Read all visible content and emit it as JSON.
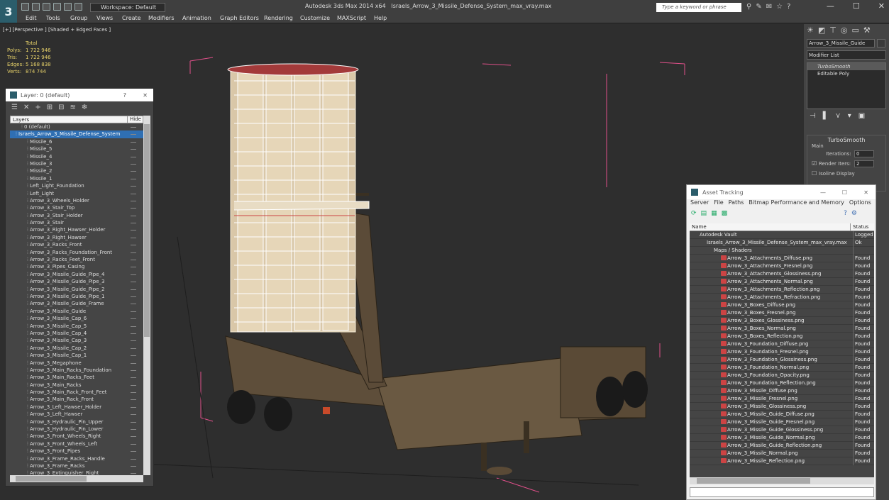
{
  "app": {
    "title": "Autodesk 3ds Max  2014 x64",
    "file": "Israels_Arrow_3_Missile_Defense_System_max_vray.max",
    "workspace": "Workspace: Default",
    "search_placeholder": "Type a keyword or phrase",
    "minimize": "—",
    "maximize": "☐",
    "close": "✕"
  },
  "menu": [
    "Edit",
    "Tools",
    "Group",
    "Views",
    "Create",
    "Modifiers",
    "Animation",
    "Graph Editors",
    "Rendering",
    "Customize",
    "MAXScript",
    "Help"
  ],
  "viewport": {
    "label": "[+] [Perspective ] [Shaded + Edged Faces ]",
    "stats": {
      "title": "Total",
      "polys_label": "Polys:",
      "polys": "1 722 946",
      "tris_label": "Tris:",
      "tris": "1 722 946",
      "edges_label": "Edges:",
      "edges": "5 168 838",
      "verts_label": "Verts:",
      "verts": "874 744"
    }
  },
  "layer_panel": {
    "title": "Layer: 0 (default)",
    "help": "?",
    "close": "✕",
    "col_layers": "Layers",
    "col_hide": "Hide",
    "items": [
      {
        "label": "0 (default)",
        "indent": 2,
        "selected": false
      },
      {
        "label": "Israels_Arrow_3_Missile_Defense_System",
        "indent": 1,
        "selected": true
      },
      {
        "label": "Missile_6",
        "indent": 3
      },
      {
        "label": "Missile_5",
        "indent": 3
      },
      {
        "label": "Missile_4",
        "indent": 3
      },
      {
        "label": "Missile_3",
        "indent": 3
      },
      {
        "label": "Missile_2",
        "indent": 3
      },
      {
        "label": "Missile_1",
        "indent": 3
      },
      {
        "label": "Left_Light_Foundation",
        "indent": 3
      },
      {
        "label": "Left_Light",
        "indent": 3
      },
      {
        "label": "Arrow_3_Wheels_Holder",
        "indent": 3
      },
      {
        "label": "Arrow_3_Stair_Top",
        "indent": 3
      },
      {
        "label": "Arrow_3_Stair_Holder",
        "indent": 3
      },
      {
        "label": "Arrow_3_Stair",
        "indent": 3
      },
      {
        "label": "Arrow_3_Right_Hawser_Holder",
        "indent": 3
      },
      {
        "label": "Arrow_3_Right_Hawser",
        "indent": 3
      },
      {
        "label": "Arrow_3_Racks_Front",
        "indent": 3
      },
      {
        "label": "Arrow_3_Racks_Foundation_Front",
        "indent": 3
      },
      {
        "label": "Arrow_3_Racks_Feet_Front",
        "indent": 3
      },
      {
        "label": "Arrow_3_Pipes_Casing",
        "indent": 3
      },
      {
        "label": "Arrow_3_Missile_Guide_Pipe_4",
        "indent": 3
      },
      {
        "label": "Arrow_3_Missile_Guide_Pipe_3",
        "indent": 3
      },
      {
        "label": "Arrow_3_Missile_Guide_Pipe_2",
        "indent": 3
      },
      {
        "label": "Arrow_3_Missile_Guide_Pipe_1",
        "indent": 3
      },
      {
        "label": "Arrow_3_Missile_Guide_Frame",
        "indent": 3
      },
      {
        "label": "Arrow_3_Missile_Guide",
        "indent": 3
      },
      {
        "label": "Arrow_3_Missile_Cap_6",
        "indent": 3
      },
      {
        "label": "Arrow_3_Missile_Cap_5",
        "indent": 3
      },
      {
        "label": "Arrow_3_Missile_Cap_4",
        "indent": 3
      },
      {
        "label": "Arrow_3_Missile_Cap_3",
        "indent": 3
      },
      {
        "label": "Arrow_3_Missile_Cap_2",
        "indent": 3
      },
      {
        "label": "Arrow_3_Missile_Cap_1",
        "indent": 3
      },
      {
        "label": "Arrow_3_Megaphone",
        "indent": 3
      },
      {
        "label": "Arrow_3_Main_Racks_Foundation",
        "indent": 3
      },
      {
        "label": "Arrow_3_Main_Racks_Feet",
        "indent": 3
      },
      {
        "label": "Arrow_3_Main_Racks",
        "indent": 3
      },
      {
        "label": "Arrow_3_Main_Rack_Front_Feet",
        "indent": 3
      },
      {
        "label": "Arrow_3_Main_Rack_Front",
        "indent": 3
      },
      {
        "label": "Arrow_3_Left_Hawser_Holder",
        "indent": 3
      },
      {
        "label": "Arrow_3_Left_Hawser",
        "indent": 3
      },
      {
        "label": "Arrow_3_Hydraulic_Pin_Upper",
        "indent": 3
      },
      {
        "label": "Arrow_3_Hydraulic_Pin_Lower",
        "indent": 3
      },
      {
        "label": "Arrow_3_Front_Wheels_Right",
        "indent": 3
      },
      {
        "label": "Arrow_3_Front_Wheels_Left",
        "indent": 3
      },
      {
        "label": "Arrow_3_Front_Pipes",
        "indent": 3
      },
      {
        "label": "Arrow_3_Frame_Racks_Handle",
        "indent": 3
      },
      {
        "label": "Arrow_3_Frame_Racks",
        "indent": 3
      },
      {
        "label": "Arrow_3_Extinguisher_Right",
        "indent": 3
      }
    ]
  },
  "command_panel": {
    "object_name": "Arrow_3_Missile_Guide",
    "modifier_list": "Modifier List",
    "stack": [
      "TurboSmooth",
      "Editable Poly"
    ],
    "rollout_title": "TurboSmooth",
    "main_label": "Main",
    "iterations_label": "Iterations:",
    "iterations": "0",
    "render_iters_label": "Render Iters:",
    "render_iters": "2",
    "isoline_label": "Isoline Display"
  },
  "asset_panel": {
    "title": "Asset Tracking",
    "menu": [
      "Server",
      "File",
      "Paths",
      "Bitmap Performance and Memory",
      "Options"
    ],
    "col_name": "Name",
    "col_status": "Status",
    "rows": [
      {
        "name": "Autodesk Vault",
        "status": "Logged",
        "indent": 14,
        "icon": false
      },
      {
        "name": "Israels_Arrow_3_Missile_Defense_System_max_vray.max",
        "status": "Ok",
        "indent": 24,
        "icon": false
      },
      {
        "name": "Maps / Shaders",
        "status": "",
        "indent": 34,
        "icon": false
      },
      {
        "name": "Arrow_3_Attachments_Diffuse.png",
        "status": "Found",
        "indent": 44,
        "icon": true
      },
      {
        "name": "Arrow_3_Attachments_Fresnel.png",
        "status": "Found",
        "indent": 44,
        "icon": true
      },
      {
        "name": "Arrow_3_Attachments_Glossiness.png",
        "status": "Found",
        "indent": 44,
        "icon": true
      },
      {
        "name": "Arrow_3_Attachments_Normal.png",
        "status": "Found",
        "indent": 44,
        "icon": true
      },
      {
        "name": "Arrow_3_Attachments_Reflection.png",
        "status": "Found",
        "indent": 44,
        "icon": true
      },
      {
        "name": "Arrow_3_Attachments_Refraction.png",
        "status": "Found",
        "indent": 44,
        "icon": true
      },
      {
        "name": "Arrow_3_Boxes_Diffuse.png",
        "status": "Found",
        "indent": 44,
        "icon": true
      },
      {
        "name": "Arrow_3_Boxes_Fresnel.png",
        "status": "Found",
        "indent": 44,
        "icon": true
      },
      {
        "name": "Arrow_3_Boxes_Glossiness.png",
        "status": "Found",
        "indent": 44,
        "icon": true
      },
      {
        "name": "Arrow_3_Boxes_Normal.png",
        "status": "Found",
        "indent": 44,
        "icon": true
      },
      {
        "name": "Arrow_3_Boxes_Reflection.png",
        "status": "Found",
        "indent": 44,
        "icon": true
      },
      {
        "name": "Arrow_3_Foundation_Diffuse.png",
        "status": "Found",
        "indent": 44,
        "icon": true
      },
      {
        "name": "Arrow_3_Foundation_Fresnel.png",
        "status": "Found",
        "indent": 44,
        "icon": true
      },
      {
        "name": "Arrow_3_Foundation_Glossiness.png",
        "status": "Found",
        "indent": 44,
        "icon": true
      },
      {
        "name": "Arrow_3_Foundation_Normal.png",
        "status": "Found",
        "indent": 44,
        "icon": true
      },
      {
        "name": "Arrow_3_Foundation_Opacity.png",
        "status": "Found",
        "indent": 44,
        "icon": true
      },
      {
        "name": "Arrow_3_Foundation_Reflection.png",
        "status": "Found",
        "indent": 44,
        "icon": true
      },
      {
        "name": "Arrow_3_Missile_Diffuse.png",
        "status": "Found",
        "indent": 44,
        "icon": true
      },
      {
        "name": "Arrow_3_Missile_Fresnel.png",
        "status": "Found",
        "indent": 44,
        "icon": true
      },
      {
        "name": "Arrow_3_Missile_Glossiness.png",
        "status": "Found",
        "indent": 44,
        "icon": true
      },
      {
        "name": "Arrow_3_Missile_Guide_Diffuse.png",
        "status": "Found",
        "indent": 44,
        "icon": true
      },
      {
        "name": "Arrow_3_Missile_Guide_Fresnel.png",
        "status": "Found",
        "indent": 44,
        "icon": true
      },
      {
        "name": "Arrow_3_Missile_Guide_Glossiness.png",
        "status": "Found",
        "indent": 44,
        "icon": true
      },
      {
        "name": "Arrow_3_Missile_Guide_Normal.png",
        "status": "Found",
        "indent": 44,
        "icon": true
      },
      {
        "name": "Arrow_3_Missile_Guide_Reflection.png",
        "status": "Found",
        "indent": 44,
        "icon": true
      },
      {
        "name": "Arrow_3_Missile_Normal.png",
        "status": "Found",
        "indent": 44,
        "icon": true
      },
      {
        "name": "Arrow_3_Missile_Reflection.png",
        "status": "Found",
        "indent": 44,
        "icon": true
      }
    ]
  }
}
